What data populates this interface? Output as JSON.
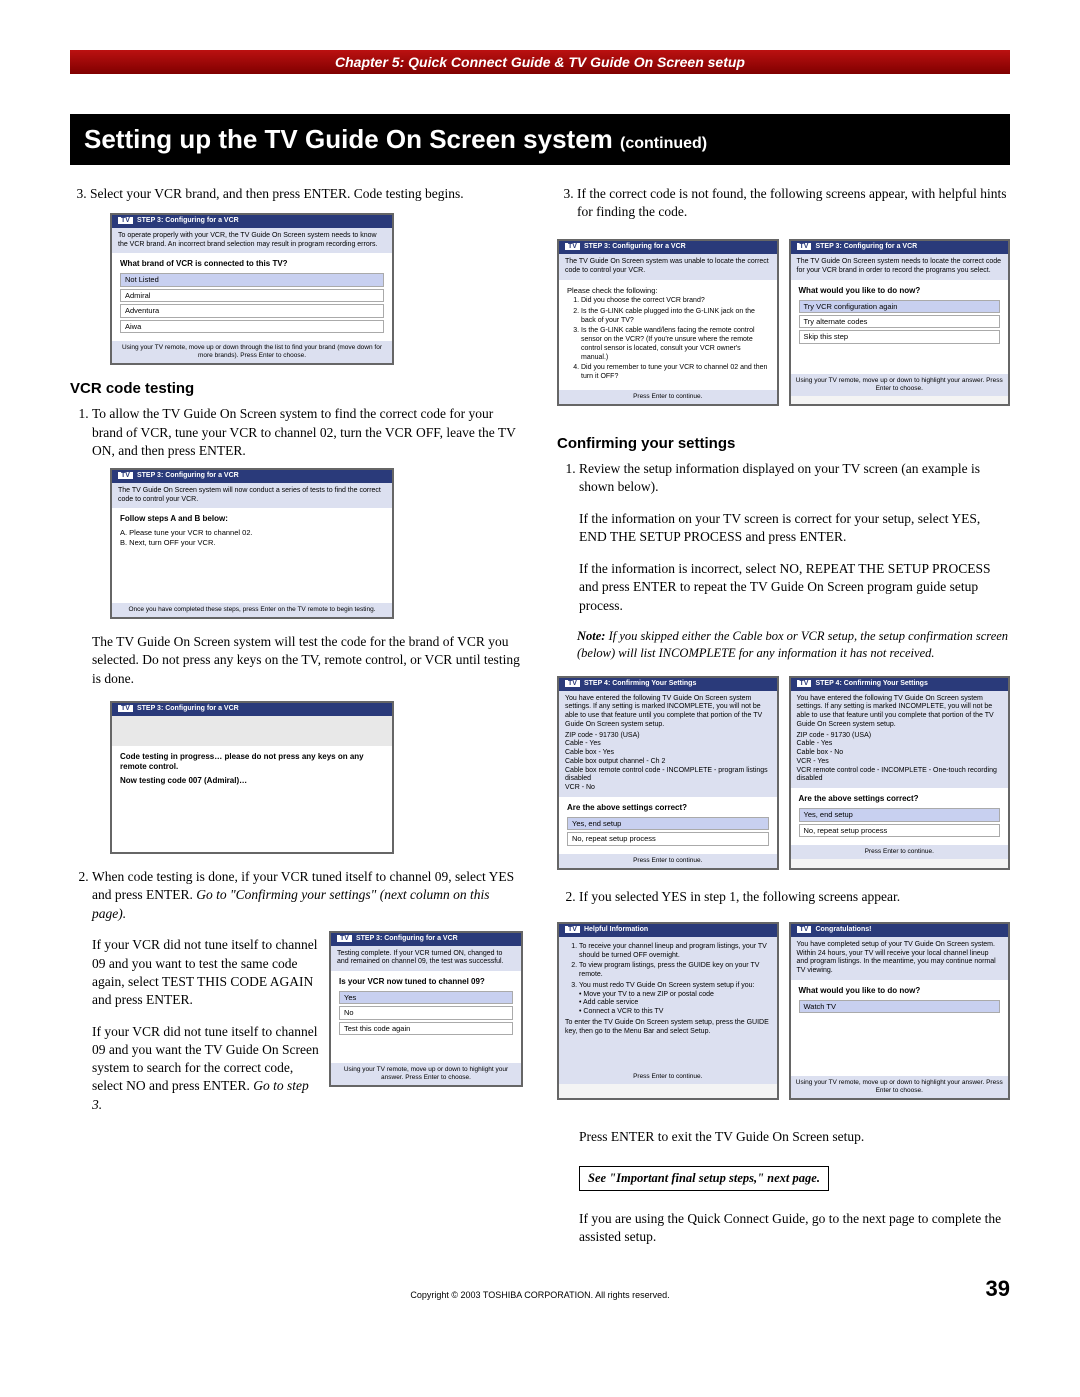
{
  "chapter": "Chapter 5: Quick Connect Guide & TV Guide On Screen setup",
  "title": "Setting up the TV Guide On Screen system",
  "title_cont": "(continued)",
  "left": {
    "step3": "Select your VCR brand, and then press ENTER. Code testing begins.",
    "ss1": {
      "title": "STEP 3: Configuring for a VCR",
      "note": "To operate properly with your VCR, the TV Guide On Screen system needs to know the VCR brand. An incorrect brand selection may result in program recording errors.",
      "q": "What brand of VCR is connected to this TV?",
      "opts": [
        "Not Listed",
        "Admiral",
        "Adventura",
        "Aiwa"
      ],
      "foot": "Using your TV remote, move up or down through the list to find your brand (move down for more brands). Press Enter to choose."
    },
    "h_vcr": "VCR code testing",
    "vcr1": "To allow the TV Guide On Screen system to find the correct code for your brand of VCR, tune your VCR to channel 02, turn the VCR OFF, leave the TV ON, and then press ENTER.",
    "ss2": {
      "title": "STEP 3: Configuring for a VCR",
      "note": "The TV Guide On Screen system will now conduct a series of tests to find the correct code to control your VCR.",
      "q": "Follow steps A and B below:",
      "a": "A.  Please tune your VCR to channel 02.",
      "b": "B.  Next, turn OFF your VCR.",
      "foot": "Once you have completed these steps, press Enter on the TV remote to begin testing."
    },
    "p_after_ss2": "The TV Guide On Screen system will test the code for the brand of VCR you selected. Do not press any keys on the TV, remote control, or VCR until testing is done.",
    "ss3": {
      "title": "STEP 3: Configuring for a VCR",
      "line1": "Code testing in progress… please do not press any keys on any remote control.",
      "line2": "Now testing code 007 (Admiral)…"
    },
    "vcr2_a": "When code testing is done, if your VCR tuned itself to channel 09, select YES and press ENTER. ",
    "vcr2_b": "Go to \"Confirming your settings\" (next column on this page).",
    "p_after_vcr2_a": "If your VCR did not tune itself to channel 09 and you want to test the same code again, select TEST THIS CODE AGAIN and press ENTER.",
    "ss4": {
      "title": "STEP 3: Configuring for a VCR",
      "note": "Testing complete. If your VCR turned ON, changed to and remained on channel 09, the test was successful.",
      "q": "Is your VCR now tuned to channel 09?",
      "opts": [
        "Yes",
        "No",
        "Test this code again"
      ],
      "foot": "Using your TV remote, move up or down to highlight your answer. Press Enter to choose."
    },
    "p_after_vcr2_b": "If your VCR did not tune itself to channel 09 and you want the TV Guide On Screen system to search for the correct code, select NO and press ENTER. ",
    "p_after_vcr2_c": "Go to step 3."
  },
  "right": {
    "step3": "If the correct code is not found, the following screens appear, with helpful hints for finding the code.",
    "ss5a": {
      "title": "STEP 3: Configuring for a VCR",
      "note": "The TV Guide On Screen system was unable to locate the correct code to control your VCR.",
      "q": "Please check the following:",
      "c1": "Did you choose the correct VCR brand?",
      "c2": "Is the G-LINK cable plugged into the G-LINK jack on the back of your TV?",
      "c3": "Is the G-LINK cable wand/lens facing the remote control sensor on the VCR? (If you're unsure where the remote control sensor is located, consult your VCR owner's manual.)",
      "c4": "Did you remember to tune your VCR to channel 02 and then turn it OFF?",
      "foot": "Press Enter to continue."
    },
    "ss5b": {
      "title": "STEP 3: Configuring for a VCR",
      "note": "The TV Guide On Screen system needs to locate the correct code for your VCR brand in order to record the programs you select.",
      "q": "What would you like to do now?",
      "opts": [
        "Try VCR configuration again",
        "Try alternate codes",
        "Skip this step"
      ],
      "foot": "Using your TV remote, move up or down to highlight your answer. Press Enter to choose."
    },
    "h_confirm": "Confirming your settings",
    "c1": "Review the setup information displayed on your TV screen (an example is shown below).",
    "c1b": "If the information on your TV screen is correct for your setup, select YES, END THE SETUP PROCESS and press ENTER.",
    "c1c": "If the information is incorrect, select NO, REPEAT THE SETUP PROCESS and press ENTER to repeat the TV Guide On Screen program guide setup process.",
    "note_label": "Note:",
    "note": " If you skipped either the Cable box or VCR setup, the setup confirmation screen (below) will list INCOMPLETE for any information it has not received.",
    "ss6a": {
      "title": "STEP 4: Confirming Your Settings",
      "note": "You have entered the following TV Guide On Screen system settings. If any setting is marked INCOMPLETE, you will not be able to use that feature until you complete that portion of the TV Guide On Screen system setup.",
      "lines": [
        "ZIP code - 91730 (USA)",
        "Cable - Yes",
        "Cable box - Yes",
        "Cable box output channel - Ch 2",
        "Cable box remote control code - INCOMPLETE - program listings disabled",
        "VCR - No"
      ],
      "q": "Are the above settings correct?",
      "opts": [
        "Yes, end setup",
        "No, repeat setup process"
      ],
      "foot": "Press Enter to continue."
    },
    "ss6b": {
      "title": "STEP 4: Confirming Your Settings",
      "note": "You have entered the following TV Guide On Screen system settings. If any setting is marked INCOMPLETE, you will not be able to use that feature until you complete that portion of the TV Guide On Screen system setup.",
      "lines": [
        "ZIP code - 91730 (USA)",
        "Cable - Yes",
        "Cable box - No",
        "VCR - Yes",
        "VCR remote control code - INCOMPLETE - One-touch recording disabled"
      ],
      "q": "Are the above settings correct?",
      "opts": [
        "Yes, end setup",
        "No, repeat setup process"
      ],
      "foot": "Press Enter to continue."
    },
    "c2": "If you selected YES in step 1, the following screens appear.",
    "ss7a": {
      "title": "Helpful Information",
      "c1": "To receive your channel lineup and program listings, your TV should be turned OFF overnight.",
      "c2": "To view program listings, press the GUIDE key on your TV remote.",
      "c3": "You must redo TV Guide On Screen system setup if you:",
      "c3a": "• Move your TV to a new ZIP or postal code",
      "c3b": "• Add cable service",
      "c3c": "• Connect a VCR to this TV",
      "c4": "To enter the TV Guide On Screen system setup, press the GUIDE key, then go to the Menu Bar and select Setup.",
      "foot": "Press Enter to continue."
    },
    "ss7b": {
      "title": "Congratulations!",
      "note": "You have completed setup of your TV Guide On Screen system. Within 24 hours, your TV will receive your local channel lineup and program listings. In the meantime, you may continue normal TV viewing.",
      "q": "What would you like to do now?",
      "opts": [
        "Watch TV"
      ],
      "foot": "Using your TV remote, move up or down to highlight your answer. Press Enter to choose."
    },
    "p_press": "Press ENTER to exit the TV Guide On Screen setup.",
    "callout": "See \"Important final setup steps,\" next page.",
    "p_final": "If you are using the Quick Connect Guide, go to the next page to complete the assisted setup."
  },
  "footer": "Copyright © 2003 TOSHIBA CORPORATION. All rights reserved.",
  "page": "39"
}
